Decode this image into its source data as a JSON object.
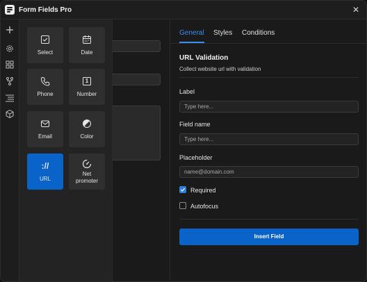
{
  "app": {
    "title": "Form Fields Pro",
    "close_icon": "close-icon"
  },
  "rail": {
    "icons": [
      "plus-icon",
      "gear-icon",
      "blocks-icon",
      "tree-icon",
      "indent-list-icon",
      "cube-icon"
    ]
  },
  "picker": {
    "fields": [
      {
        "label": "Select",
        "icon": "checkbox-icon",
        "active": false
      },
      {
        "label": "Date",
        "icon": "calendar-icon",
        "active": false
      },
      {
        "label": "Phone",
        "icon": "phone-icon",
        "active": false
      },
      {
        "label": "Number",
        "icon": "number-box-icon",
        "glyph": "1",
        "active": false
      },
      {
        "label": "Email",
        "icon": "envelope-icon",
        "active": false
      },
      {
        "label": "Color",
        "icon": "color-wheel-icon",
        "active": false
      },
      {
        "label": "URL",
        "icon": "url-icon",
        "glyph": "://",
        "active": true
      },
      {
        "label": "Net promoter",
        "label_lines": [
          "Net",
          "promoter"
        ],
        "icon": "gauge-icon",
        "active": false
      }
    ]
  },
  "panel": {
    "tabs": [
      {
        "label": "General",
        "active": true
      },
      {
        "label": "Styles",
        "active": false
      },
      {
        "label": "Conditions",
        "active": false
      }
    ],
    "section_title": "URL Validation",
    "section_desc": "Collect website url with validation",
    "fields": {
      "label": {
        "label": "Label",
        "value": "",
        "placeholder": "Type here..."
      },
      "field_name": {
        "label": "Field name",
        "value": "",
        "placeholder": "Type here..."
      },
      "placeholder": {
        "label": "Placeholder",
        "value": "",
        "placeholder": "name@domain.com"
      }
    },
    "required": {
      "label": "Required",
      "checked": true
    },
    "autofocus": {
      "label": "Autofocus",
      "checked": false
    },
    "insert_button": "Insert Field"
  },
  "colors": {
    "accent": "#0a63c8",
    "link": "#3a8ef0",
    "bg": "#1a1a1a",
    "tile": "#2f2f2f"
  }
}
